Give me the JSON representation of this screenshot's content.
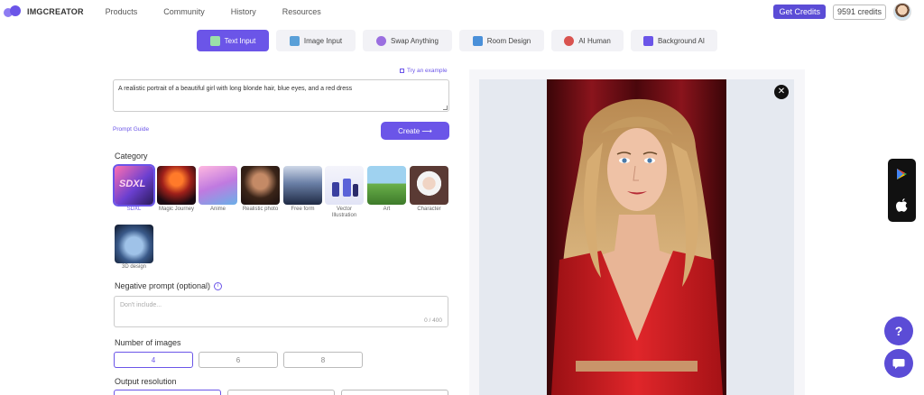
{
  "header": {
    "logo_text": "IMGCREATOR",
    "nav": [
      "Products",
      "Community",
      "History",
      "Resources"
    ],
    "get_credits": "Get Credits",
    "credits": "9591 credits"
  },
  "tabs": [
    {
      "label": "Text Input",
      "icon": "text-icon",
      "active": true
    },
    {
      "label": "Image Input",
      "icon": "image-icon",
      "active": false
    },
    {
      "label": "Swap Anything",
      "icon": "swap-icon",
      "active": false
    },
    {
      "label": "Room Design",
      "icon": "room-icon",
      "active": false
    },
    {
      "label": "AI Human",
      "icon": "human-icon",
      "active": false
    },
    {
      "label": "Background AI",
      "icon": "background-icon",
      "active": false
    }
  ],
  "form": {
    "try_example": "Try an example",
    "prompt_value": "A realistic portrait of a beautiful girl with long blonde hair, blue eyes, and a red dress",
    "prompt_guide": "Prompt Guide",
    "create_label": "Create ⟶",
    "category_label": "Category",
    "categories": [
      {
        "label": "SDXL",
        "selected": true
      },
      {
        "label": "Magic Journey",
        "selected": false
      },
      {
        "label": "Anime",
        "selected": false
      },
      {
        "label": "Realistic photo",
        "selected": false
      },
      {
        "label": "Free form",
        "selected": false
      },
      {
        "label": "Vector Illustration",
        "selected": false
      },
      {
        "label": "Art",
        "selected": false
      },
      {
        "label": "Character",
        "selected": false
      },
      {
        "label": "3D design",
        "selected": false
      }
    ],
    "negative_label": "Negative prompt (optional)",
    "negative_placeholder": "Don't include...",
    "negative_count": "0 / 400",
    "num_images_label": "Number of images",
    "num_images": [
      "4",
      "6",
      "8"
    ],
    "selected_num": "4",
    "output_resolution_label": "Output resolution"
  },
  "preview": {
    "close_icon": "close-icon"
  },
  "side": {
    "google_play_icon": "google-play-icon",
    "apple_icon": "apple-icon",
    "help": "?",
    "chat_icon": "chat-icon"
  }
}
